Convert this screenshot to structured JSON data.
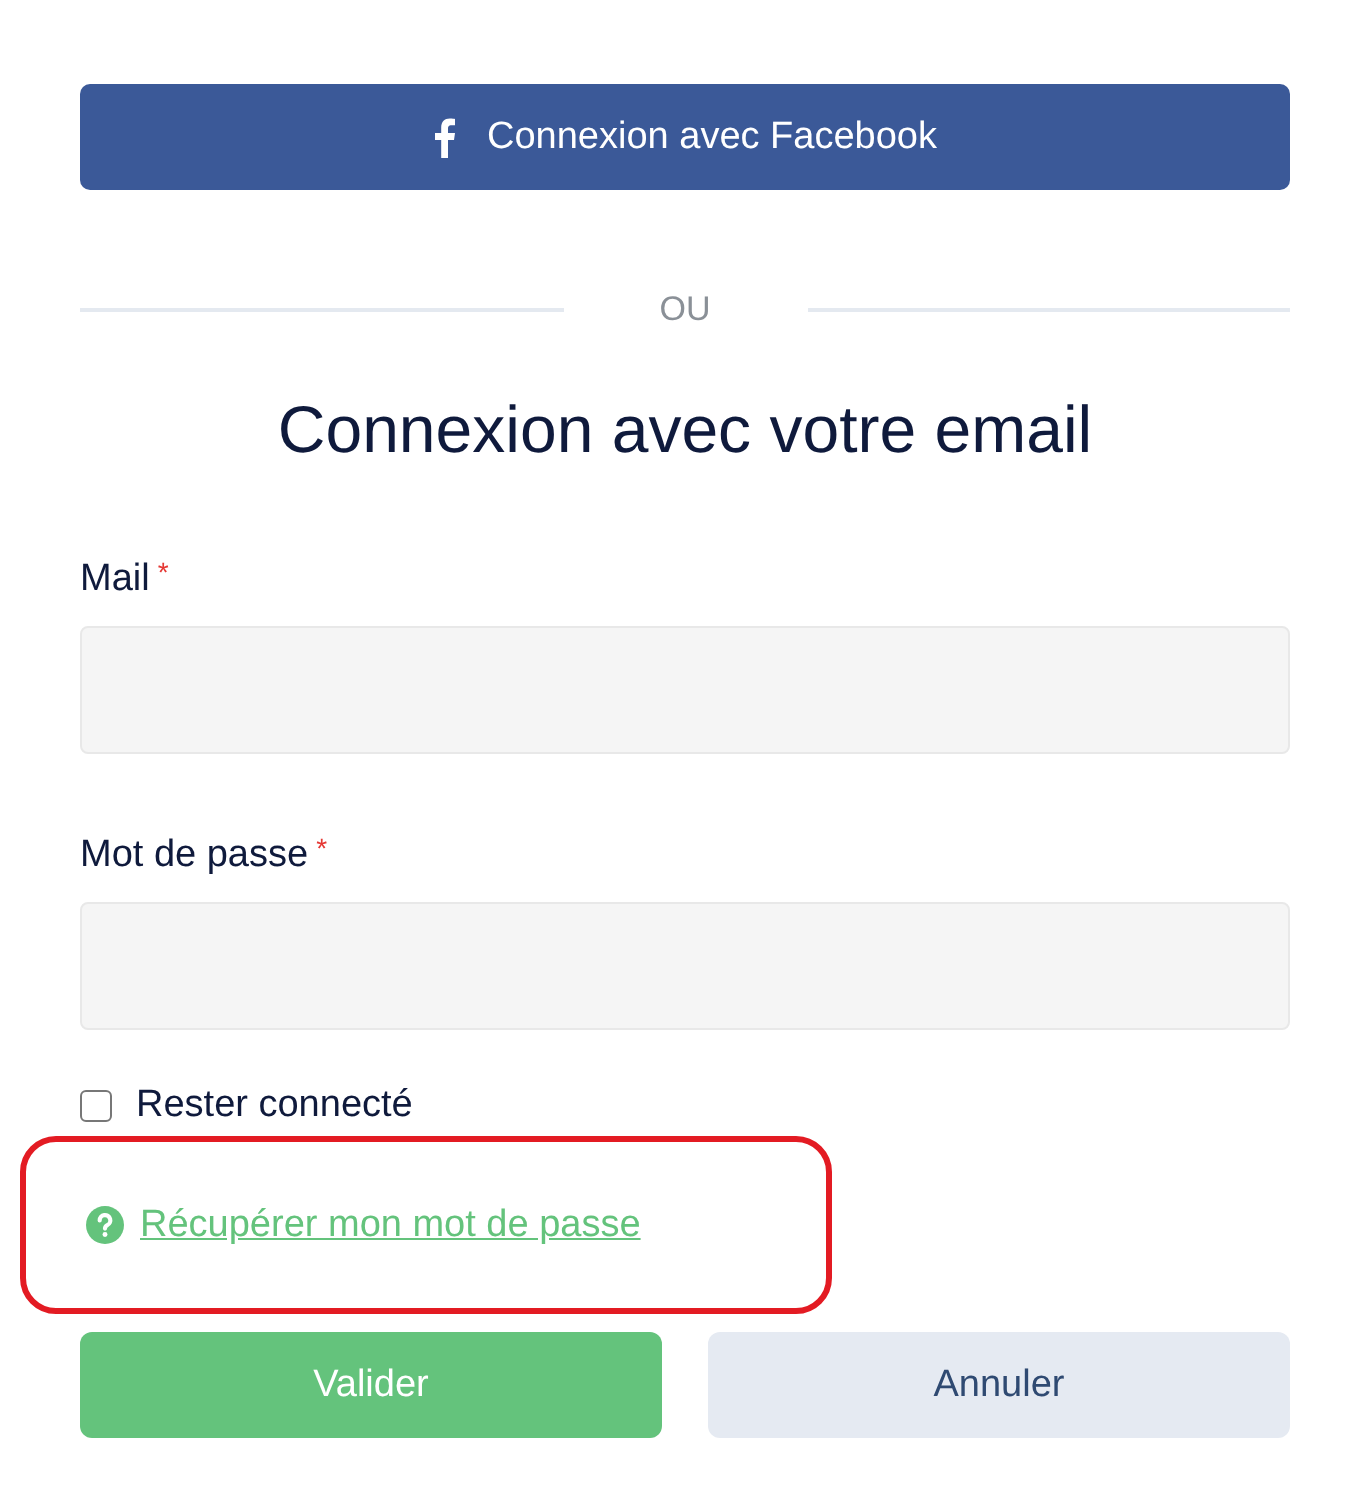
{
  "facebook_button": {
    "label": "Connexion avec Facebook"
  },
  "divider": {
    "label": "OU"
  },
  "heading": "Connexion avec votre email",
  "fields": [
    {
      "label": "Mail",
      "required_mark": "*"
    },
    {
      "label": "Mot de passe",
      "required_mark": "*"
    }
  ],
  "remember": {
    "label": "Rester connecté",
    "checked": false
  },
  "recover_link": {
    "label": "Récupérer mon mot de passe",
    "highlighted": true
  },
  "buttons": [
    {
      "label": "Valider",
      "kind": "primary"
    },
    {
      "label": "Annuler",
      "kind": "secondary"
    }
  ]
}
